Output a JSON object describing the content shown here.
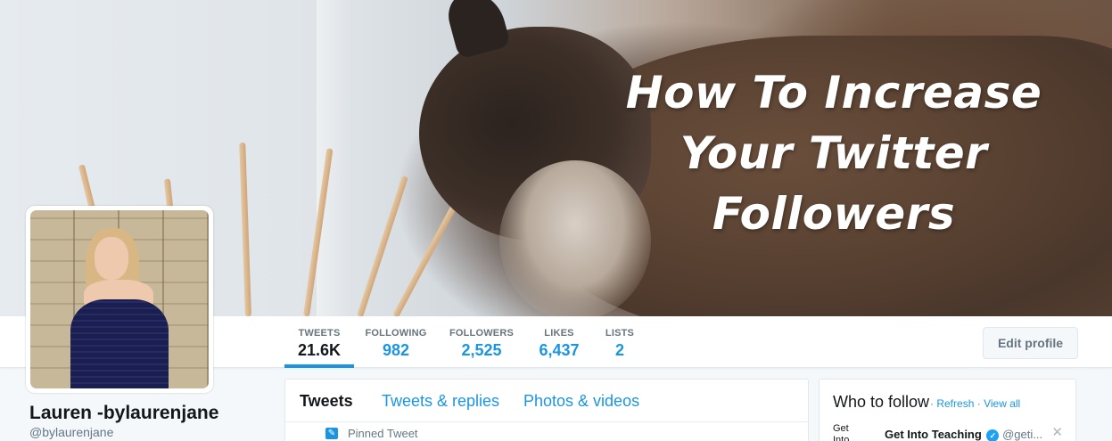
{
  "banner": {
    "headline": "How To Increase Your Twitter Followers"
  },
  "stats": [
    {
      "label": "TWEETS",
      "value": "21.6K",
      "active": true
    },
    {
      "label": "FOLLOWING",
      "value": "982"
    },
    {
      "label": "FOLLOWERS",
      "value": "2,525"
    },
    {
      "label": "LIKES",
      "value": "6,437"
    },
    {
      "label": "LISTS",
      "value": "2"
    }
  ],
  "actions": {
    "edit_profile": "Edit profile"
  },
  "profile": {
    "name": "Lauren -bylaurenjane",
    "handle": "@bylaurenjane"
  },
  "timeline": {
    "tabs": [
      "Tweets",
      "Tweets & replies",
      "Photos & videos"
    ],
    "pinned_label": "Pinned Tweet"
  },
  "who_to_follow": {
    "title": "Who to follow",
    "separator": "·",
    "refresh": "Refresh",
    "view_all": "View all",
    "suggestion": {
      "thumb_text": "Get Into",
      "name": "Get Into Teaching",
      "handle": "@geti..."
    }
  },
  "colors": {
    "accent": "#1b95e0",
    "text": "#14171a",
    "muted": "#657786"
  },
  "icons": [
    "pin-icon",
    "verified-icon",
    "close-icon"
  ]
}
